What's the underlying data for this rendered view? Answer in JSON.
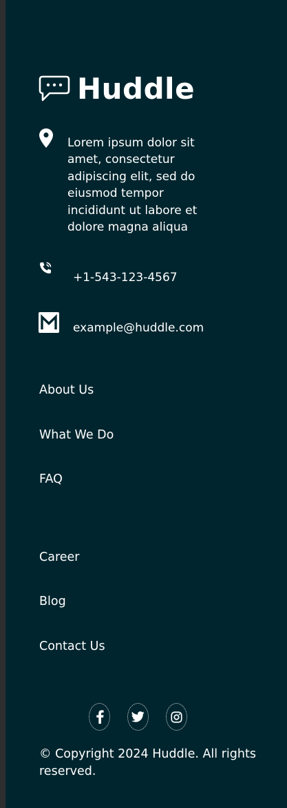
{
  "brand": {
    "name": "Huddle"
  },
  "contact": {
    "address": "Lorem ipsum dolor sit amet, consectetur adipiscing elit, sed do eiusmod tempor incididunt ut labore et dolore magna aliqua",
    "phone": "+1-543-123-4567",
    "email": "example@huddle.com"
  },
  "nav": {
    "group1": [
      "About Us",
      "What We Do",
      "FAQ"
    ],
    "group2": [
      "Career",
      "Blog",
      "Contact Us"
    ]
  },
  "social": [
    "facebook-icon",
    "twitter-icon",
    "instagram-icon"
  ],
  "copyright": "© Copyright 2024 Huddle. All rights reserved.",
  "colors": {
    "footer_bg": "#00252e",
    "text": "#ffffff"
  }
}
